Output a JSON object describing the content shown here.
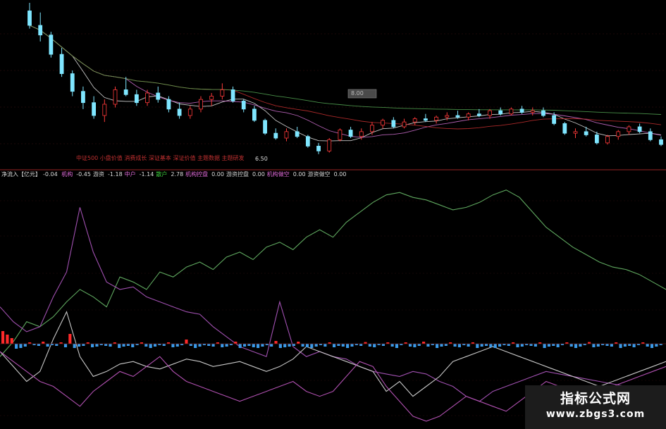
{
  "upper_panel": {
    "annotation_text": "中证500 小盘价值 消费成长 深证基本 深证价值 主题数据 主题研发",
    "low_label": "6.50",
    "box_label": "8.00"
  },
  "lower_panel": {
    "title": "净流入【亿元】",
    "title_value": "-0.04",
    "legend": [
      {
        "label": "机构",
        "value": "-0.45",
        "color": "#e06ad8"
      },
      {
        "label": "游资",
        "value": "-1.18",
        "color": "#cfcfcf"
      },
      {
        "label": "中户",
        "value": "-1.14",
        "color": "#e06ad8"
      },
      {
        "label": "散户",
        "value": "2.78",
        "color": "#3ecf3e"
      },
      {
        "label": "机构控盘",
        "value": "0.00",
        "color": "#e06ad8"
      },
      {
        "label": "游资控盘",
        "value": "0.00",
        "color": "#cfcfcf"
      },
      {
        "label": "机构做空",
        "value": "0.00",
        "color": "#e06ad8"
      },
      {
        "label": "游资做空",
        "value": "0.00",
        "color": "#cfcfcf"
      }
    ]
  },
  "watermark": {
    "title": "指标公式网",
    "url": "www.zbgs3.com"
  },
  "colors": {
    "candle_up": "#ff3a3a",
    "candle_down": "#7fe6ff",
    "ma_short": "#e8e8e8",
    "ma_mid": "#d070d0",
    "ma_long": "#c83030",
    "ma_longest": "#55a855",
    "bar_pos": "#ff2a2a",
    "bar_neg": "#3a9ae8",
    "line_retail": "#5fa85f",
    "line_inst": "#a050b0",
    "line_hot": "#c8c8c8",
    "line_mid": "#b050b0"
  },
  "chart_data": [
    {
      "type": "candlestick",
      "title": "",
      "price_range": [
        6.3,
        11.2
      ],
      "series": [
        {
          "name": "",
          "ohlc": [
            [
              10.95,
              11.2,
              10.4,
              10.5
            ],
            [
              10.5,
              10.9,
              10.0,
              10.2
            ],
            [
              10.2,
              10.3,
              9.5,
              9.6
            ],
            [
              9.6,
              9.8,
              8.9,
              9.0
            ],
            [
              9.0,
              9.1,
              8.3,
              8.45
            ],
            [
              8.45,
              8.6,
              7.9,
              8.1
            ],
            [
              8.1,
              8.3,
              7.6,
              7.7
            ],
            [
              7.7,
              8.2,
              7.5,
              8.05
            ],
            [
              8.05,
              8.6,
              7.95,
              8.5
            ],
            [
              8.5,
              8.9,
              8.3,
              8.35
            ],
            [
              8.35,
              8.5,
              8.0,
              8.1
            ],
            [
              8.1,
              8.5,
              8.0,
              8.4
            ],
            [
              8.4,
              8.6,
              8.1,
              8.2
            ],
            [
              8.2,
              8.3,
              7.8,
              7.9
            ],
            [
              7.9,
              8.1,
              7.6,
              7.7
            ],
            [
              7.7,
              8.0,
              7.6,
              7.9
            ],
            [
              7.9,
              8.3,
              7.8,
              8.2
            ],
            [
              8.2,
              8.4,
              8.0,
              8.3
            ],
            [
              8.3,
              8.7,
              8.2,
              8.5
            ],
            [
              8.5,
              8.6,
              8.1,
              8.15
            ],
            [
              8.15,
              8.2,
              7.8,
              7.9
            ],
            [
              7.9,
              8.0,
              7.5,
              7.55
            ],
            [
              7.55,
              7.6,
              7.1,
              7.15
            ],
            [
              7.15,
              7.3,
              6.95,
              7.0
            ],
            [
              7.0,
              7.3,
              6.9,
              7.2
            ],
            [
              7.2,
              7.35,
              7.0,
              7.05
            ],
            [
              7.05,
              7.1,
              6.7,
              6.75
            ],
            [
              6.75,
              6.85,
              6.5,
              6.6
            ],
            [
              6.6,
              7.0,
              6.55,
              6.95
            ],
            [
              6.95,
              7.3,
              6.9,
              7.25
            ],
            [
              7.25,
              7.35,
              7.0,
              7.05
            ],
            [
              7.05,
              7.3,
              6.95,
              7.2
            ],
            [
              7.2,
              7.5,
              7.1,
              7.4
            ],
            [
              7.4,
              7.6,
              7.3,
              7.55
            ],
            [
              7.55,
              7.65,
              7.3,
              7.35
            ],
            [
              7.35,
              7.6,
              7.3,
              7.5
            ],
            [
              7.5,
              7.65,
              7.4,
              7.6
            ],
            [
              7.6,
              7.75,
              7.5,
              7.55
            ],
            [
              7.55,
              7.7,
              7.45,
              7.65
            ],
            [
              7.65,
              7.8,
              7.55,
              7.7
            ],
            [
              7.7,
              7.85,
              7.6,
              7.65
            ],
            [
              7.65,
              7.8,
              7.55,
              7.75
            ],
            [
              7.75,
              7.9,
              7.65,
              7.7
            ],
            [
              7.7,
              7.9,
              7.6,
              7.85
            ],
            [
              7.85,
              7.95,
              7.7,
              7.75
            ],
            [
              7.75,
              7.95,
              7.7,
              7.9
            ],
            [
              7.9,
              8.0,
              7.75,
              7.8
            ],
            [
              7.8,
              7.95,
              7.7,
              7.85
            ],
            [
              7.85,
              7.95,
              7.65,
              7.7
            ],
            [
              7.7,
              7.8,
              7.4,
              7.45
            ],
            [
              7.45,
              7.5,
              7.1,
              7.15
            ],
            [
              7.15,
              7.3,
              7.0,
              7.2
            ],
            [
              7.2,
              7.35,
              7.05,
              7.1
            ],
            [
              7.1,
              7.2,
              6.8,
              6.85
            ],
            [
              6.85,
              7.1,
              6.8,
              7.05
            ],
            [
              7.05,
              7.25,
              6.95,
              7.2
            ],
            [
              7.2,
              7.4,
              7.1,
              7.35
            ],
            [
              7.35,
              7.45,
              7.15,
              7.2
            ],
            [
              7.2,
              7.3,
              6.9,
              6.95
            ],
            [
              6.95,
              7.05,
              6.75,
              6.8
            ]
          ]
        },
        {
          "name": "",
          "kind": "moving_average",
          "period": 5
        },
        {
          "name": "",
          "kind": "moving_average",
          "period": 10
        },
        {
          "name": "",
          "kind": "moving_average",
          "period": 20
        },
        {
          "name": "",
          "kind": "moving_average",
          "period": 60
        }
      ]
    },
    {
      "type": "bar",
      "title": "净流入【亿元】",
      "ylim": [
        -1.0,
        1.0
      ],
      "series": [
        {
          "name": "",
          "values": [
            0.9,
            0.65,
            0.4,
            -0.35,
            -0.3,
            -0.2,
            0.1,
            -0.1,
            -0.15,
            0.15,
            -0.2,
            -0.1,
            -0.15,
            0.1,
            -0.25,
            0.7,
            -0.3,
            -0.2,
            -0.15,
            0.1,
            -0.25,
            -0.2,
            -0.1,
            -0.15,
            -0.2,
            0.1,
            -0.3,
            -0.2,
            -0.15,
            -0.25,
            -0.1,
            0.1,
            -0.2,
            -0.3,
            -0.2,
            -0.1,
            -0.15,
            0.1,
            -0.25,
            -0.2,
            -0.1,
            0.3,
            -0.15,
            -0.3,
            -0.2,
            -0.1,
            -0.15,
            -0.2,
            0.1,
            -0.25,
            -0.2,
            -0.1,
            0.15,
            -0.3,
            -0.2,
            -0.15,
            -0.25,
            -0.3,
            -0.2,
            -0.1,
            -0.2,
            0.2,
            -0.3,
            -0.25,
            -0.2,
            -0.15,
            0.15,
            -0.2,
            -0.25,
            -0.3,
            -0.2,
            -0.1,
            -0.2,
            0.1,
            -0.25,
            -0.15,
            -0.2,
            -0.3,
            -0.2,
            -0.1,
            -0.15,
            0.12,
            -0.2,
            -0.25,
            -0.1,
            -0.15,
            0.1,
            -0.2,
            -0.3,
            -0.1,
            0.1,
            -0.2,
            -0.25,
            -0.15,
            0.15,
            -0.2,
            -0.1,
            -0.3,
            -0.2,
            -0.15,
            0.1,
            -0.2,
            -0.25,
            -0.1,
            -0.2,
            0.1,
            -0.3,
            -0.2,
            -0.15,
            -0.25,
            -0.3,
            -0.2,
            -0.1,
            -0.15,
            0.1,
            -0.25,
            -0.2,
            -0.1,
            -0.15,
            -0.2,
            0.1,
            -0.3,
            -0.2,
            -0.15,
            -0.25,
            -0.1,
            0.1,
            -0.2,
            -0.3,
            -0.2,
            -0.1,
            0.12,
            -0.25,
            -0.2,
            -0.1,
            -0.15,
            -0.2,
            0.1,
            -0.3,
            -0.2,
            -0.15,
            -0.25,
            -0.1,
            0.1,
            -0.2,
            -0.3,
            -0.2,
            -0.1
          ]
        }
      ]
    },
    {
      "type": "line",
      "title": "",
      "ylim": [
        0,
        100
      ],
      "series": [
        {
          "name": "散户",
          "values": [
            28,
            34,
            42,
            40,
            44,
            50,
            55,
            52,
            48,
            60,
            58,
            55,
            62,
            60,
            64,
            66,
            63,
            68,
            70,
            67,
            72,
            74,
            71,
            76,
            79,
            76,
            82,
            86,
            90,
            93,
            94,
            92,
            91,
            89,
            87,
            88,
            90,
            93,
            95,
            92,
            86,
            80,
            76,
            72,
            69,
            66,
            64,
            63,
            61,
            58,
            55
          ]
        },
        {
          "name": "机构",
          "values": [
            48,
            42,
            38,
            40,
            52,
            62,
            88,
            70,
            58,
            55,
            56,
            52,
            50,
            48,
            46,
            45,
            40,
            36,
            32,
            30,
            28,
            50,
            32,
            28,
            30,
            28,
            27,
            24,
            22,
            21,
            20,
            22,
            21,
            18,
            16,
            12,
            10,
            14,
            16,
            18,
            20,
            22,
            21,
            20,
            19,
            18,
            17,
            16,
            15,
            14,
            13
          ]
        },
        {
          "name": "游资",
          "values": [
            30,
            24,
            18,
            22,
            35,
            46,
            28,
            20,
            22,
            25,
            26,
            24,
            23,
            25,
            27,
            26,
            24,
            25,
            26,
            24,
            22,
            24,
            27,
            32,
            30,
            28,
            26,
            24,
            22,
            14,
            18,
            12,
            16,
            20,
            26,
            28,
            30,
            32,
            30,
            28,
            26,
            24,
            22,
            20,
            18,
            16,
            18,
            20,
            22,
            24,
            26
          ]
        },
        {
          "name": "中户",
          "values": [
            30,
            26,
            22,
            18,
            16,
            12,
            8,
            14,
            18,
            22,
            20,
            24,
            28,
            22,
            18,
            16,
            14,
            12,
            10,
            12,
            14,
            16,
            18,
            14,
            12,
            14,
            20,
            26,
            24,
            16,
            10,
            4,
            2,
            4,
            8,
            12,
            10,
            8,
            6,
            10,
            14,
            18,
            16,
            14,
            12,
            14,
            16,
            18,
            20,
            22,
            24
          ]
        }
      ]
    }
  ]
}
